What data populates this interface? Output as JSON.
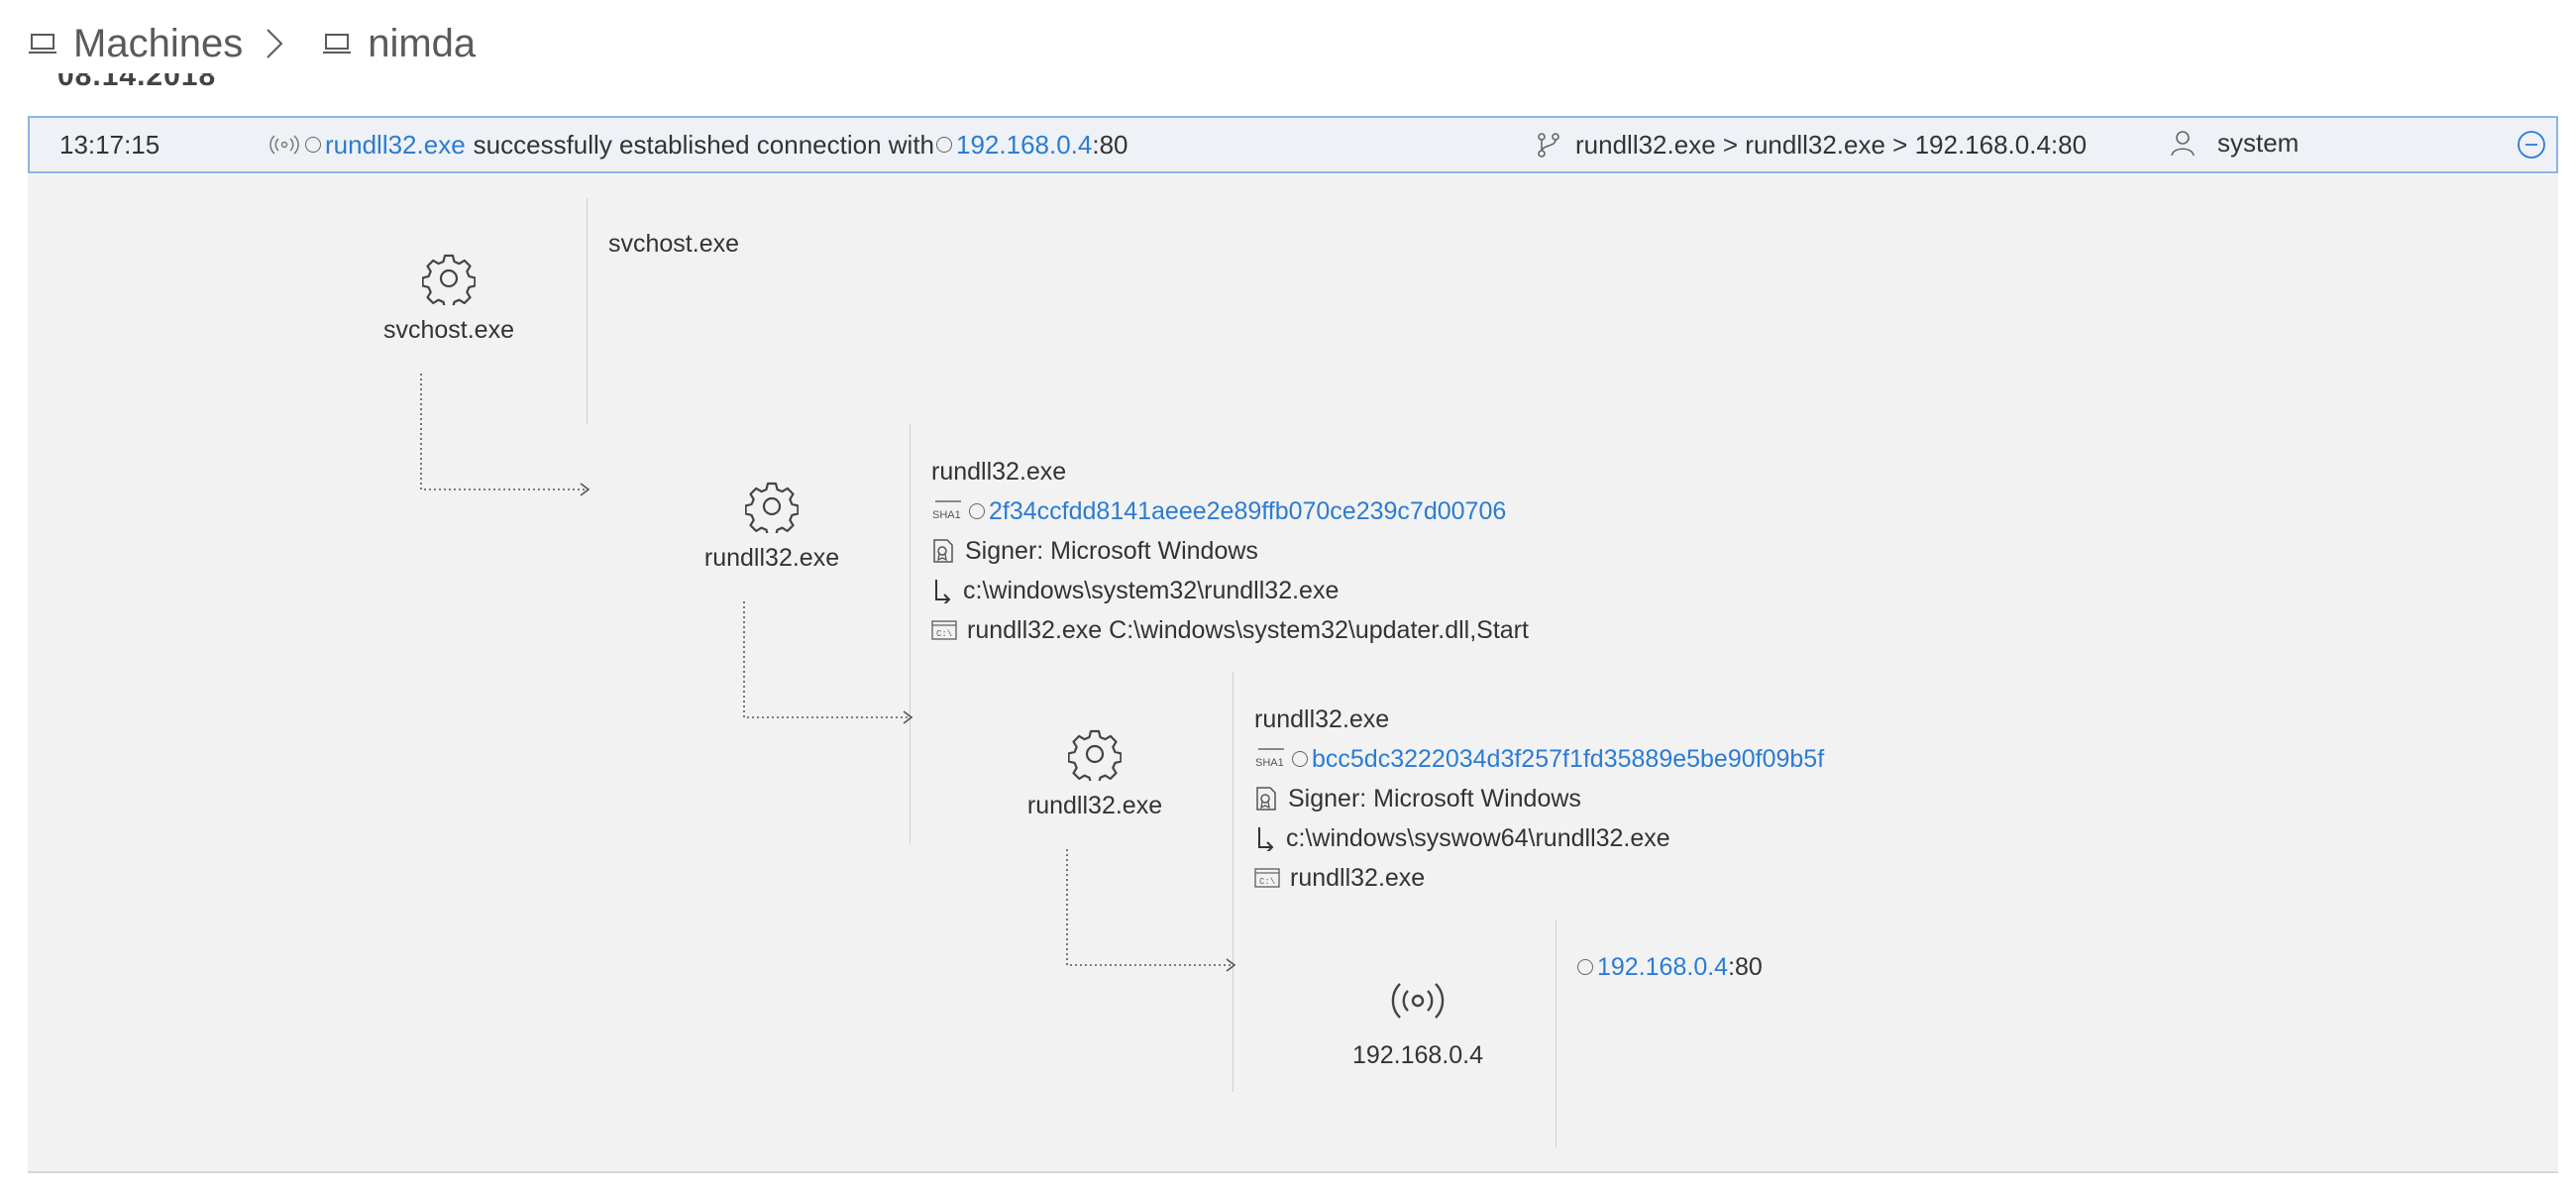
{
  "breadcrumb": {
    "root_label": "Machines",
    "machine_label": "nimda"
  },
  "date_clipped": "08.14.2018",
  "event": {
    "time": "13:17:15",
    "process": "rundll32.exe",
    "action_text": "successfully established connection with",
    "ip": "192.168.0.4",
    "port_suffix": ":80",
    "chain": "rundll32.exe > rundll32.exe > 192.168.0.4:80",
    "user": "system"
  },
  "tree": {
    "nodes": [
      {
        "label": "svchost.exe",
        "icon": "gear-icon",
        "details": {
          "name": "svchost.exe"
        }
      },
      {
        "label": "rundll32.exe",
        "icon": "gear-icon",
        "details": {
          "name": "rundll32.exe",
          "sha1": "2f34ccfdd8141aeee2e89ffb070ce239c7d00706",
          "signer": "Signer: Microsoft Windows",
          "path": "c:\\windows\\system32\\rundll32.exe",
          "cmdline": "rundll32.exe C:\\windows\\system32\\updater.dll,Start"
        }
      },
      {
        "label": "rundll32.exe",
        "icon": "gear-icon",
        "details": {
          "name": "rundll32.exe",
          "sha1": "bcc5dc3222034d3f257f1fd35889e5be90f09b5f",
          "signer": "Signer: Microsoft Windows",
          "path": "c:\\windows\\syswow64\\rundll32.exe",
          "cmdline": "rundll32.exe"
        }
      },
      {
        "label": "192.168.0.4",
        "icon": "broadcast-icon",
        "details": {
          "ip": "192.168.0.4",
          "port_suffix": ":80"
        }
      }
    ]
  },
  "colors": {
    "link": "#2b7cd3",
    "row_bg": "#eef1f6",
    "row_border": "#8bb4e8",
    "panel_bg": "#f2f2f2"
  }
}
